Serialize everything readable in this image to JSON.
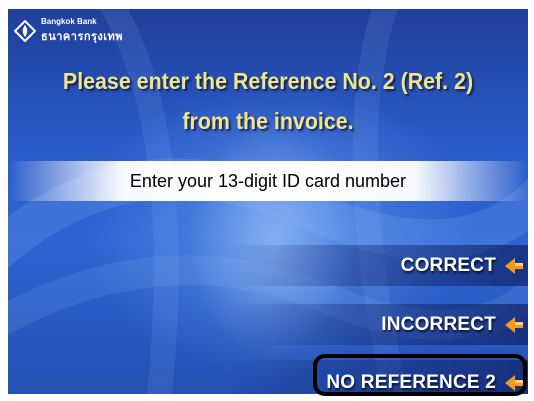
{
  "bank": {
    "name_en": "Bangkok Bank",
    "name_th": "ธนาคารกรุงเทพ",
    "logo_icon": "bangkok-bank-lotus-logo"
  },
  "prompt": {
    "line1": "Please enter the Reference No. 2 (Ref. 2)",
    "line2": "from the invoice."
  },
  "input": {
    "instruction": "Enter your 13-digit ID card number"
  },
  "options": {
    "correct": "CORRECT",
    "incorrect": "INCORRECT",
    "no_reference": "NO REFERENCE 2"
  },
  "icons": {
    "option_arrow": "orange-arrow-icon"
  },
  "colors": {
    "background": "#2a5bc8",
    "prompt_text": "#f1e58a",
    "arrow": "#f39a1f",
    "highlight_border": "#000000"
  }
}
